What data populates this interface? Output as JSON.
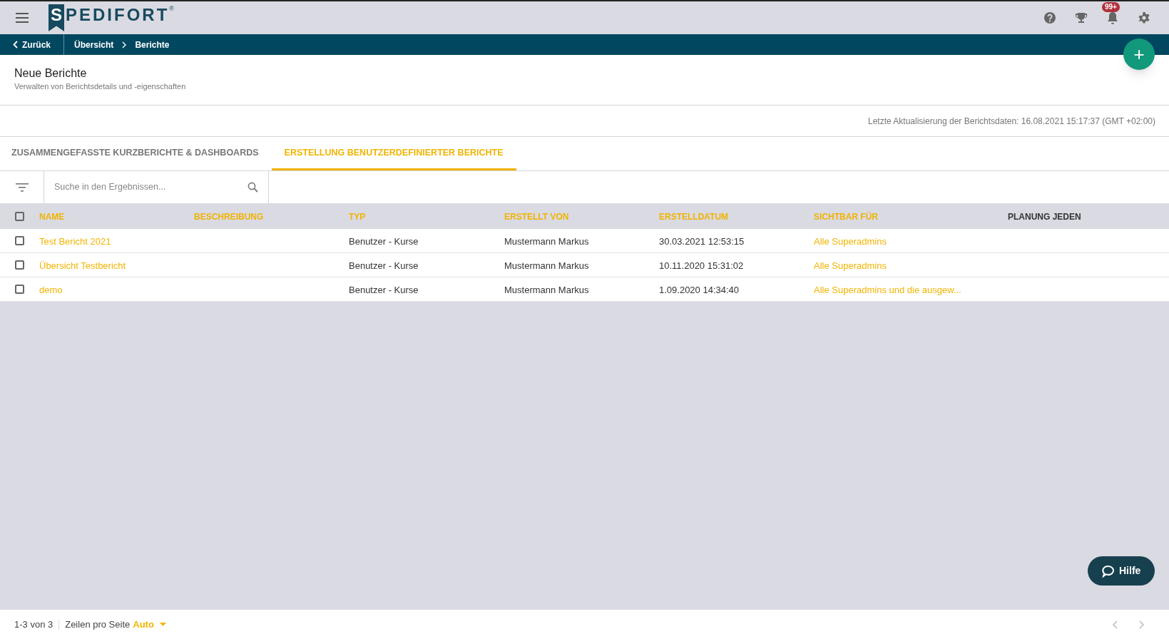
{
  "logo": {
    "mark": "S",
    "text": "PEDIFORT",
    "registered": "®"
  },
  "notifications": {
    "badge": "99+"
  },
  "breadcrumb": {
    "back": "Zurück",
    "items": [
      "Übersicht",
      "Berichte"
    ]
  },
  "fab": {
    "label": "+"
  },
  "header": {
    "title": "Neue Berichte",
    "subtitle": "Verwalten von Berichtsdetails und -eigenschaften"
  },
  "last_update": "Letzte Aktualisierung der Berichtsdaten: 16.08.2021 15:17:37 (GMT +02:00)",
  "tabs": [
    {
      "label": "ZUSAMMENGEFASSTE KURZBERICHTE & DASHBOARDS",
      "selected": false
    },
    {
      "label": "ERSTELLUNG BENUTZERDEFINIERTER BERICHTE",
      "selected": true
    }
  ],
  "search": {
    "placeholder": "Suche in den Ergebnissen..."
  },
  "table": {
    "all_checked": false,
    "columns": [
      {
        "label": "NAME",
        "sortable": true
      },
      {
        "label": "BESCHREIBUNG",
        "sortable": true
      },
      {
        "label": "TYP",
        "sortable": true
      },
      {
        "label": "ERSTELLT VON",
        "sortable": true
      },
      {
        "label": "ERSTELLDATUM",
        "sortable": true
      },
      {
        "label": "SICHTBAR FÜR",
        "sortable": true
      },
      {
        "label": "PLANUNG JEDEN",
        "sortable": false
      }
    ],
    "rows": [
      {
        "checked": false,
        "name": "Test Bericht 2021",
        "type": "Benutzer - Kurse",
        "created_by": "Mustermann Markus",
        "created_at": "30.03.2021 12:53:15",
        "visible_for": "Alle Superadmins"
      },
      {
        "checked": false,
        "name": "Übersicht Testbericht",
        "type": "Benutzer - Kurse",
        "created_by": "Mustermann Markus",
        "created_at": "10.11.2020 15:31:02",
        "visible_for": "Alle Superadmins"
      },
      {
        "checked": false,
        "name": "demo",
        "type": "Benutzer - Kurse",
        "created_by": "Mustermann Markus",
        "created_at": "1.09.2020 14:34:40",
        "visible_for": "Alle Superadmins und die ausgew..."
      }
    ]
  },
  "help_button": {
    "label": "Hilfe"
  },
  "footer": {
    "range": "1-3 von 3",
    "rows_per_page_label": "Zeilen pro Seite",
    "rows_per_page_value": "Auto"
  }
}
